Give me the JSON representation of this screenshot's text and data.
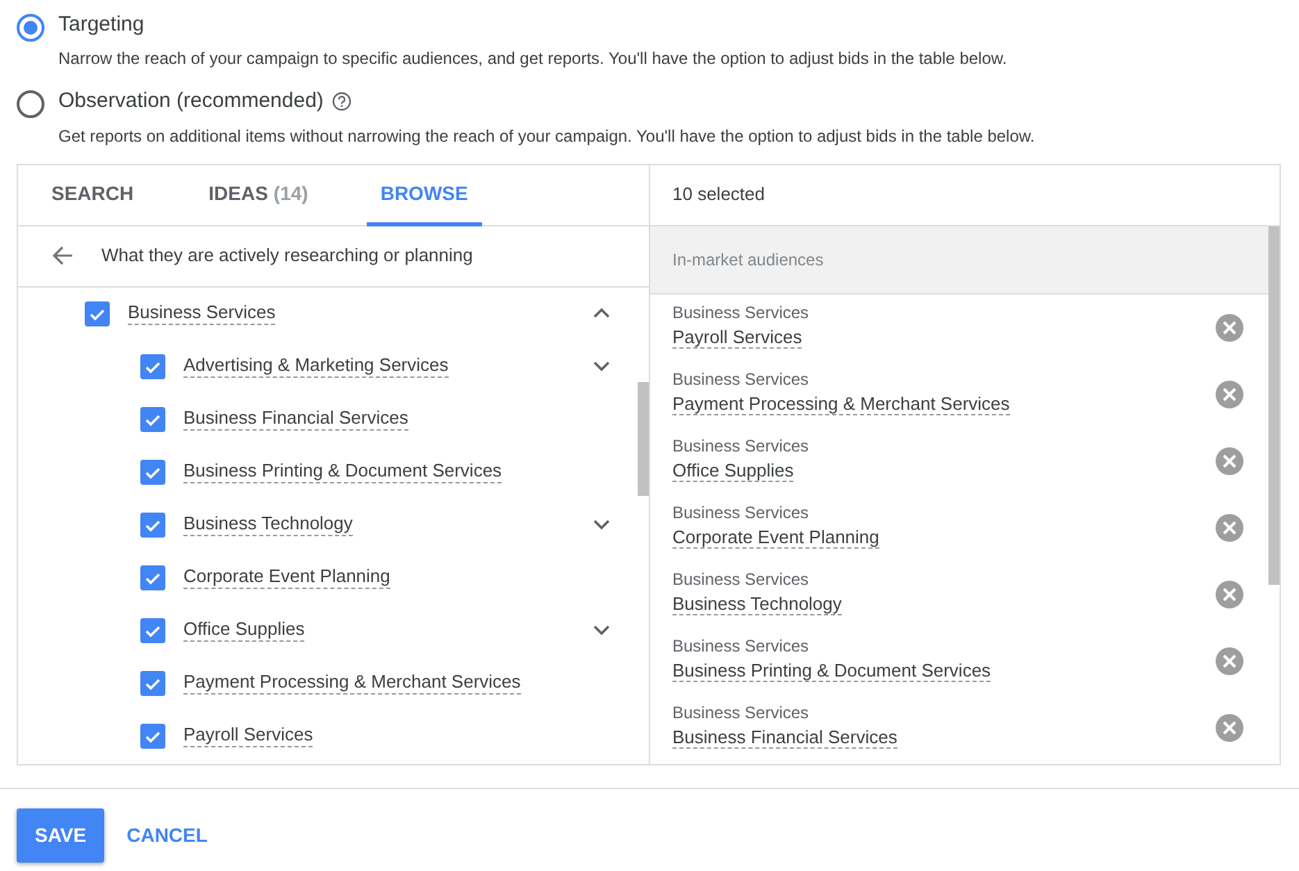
{
  "options": [
    {
      "label": "Targeting",
      "description": "Narrow the reach of your campaign to specific audiences, and get reports. You'll have the option to adjust bids in the table below.",
      "selected": true,
      "help": false
    },
    {
      "label": "Observation (recommended)",
      "description": "Get reports on additional items without narrowing the reach of your campaign. You'll have the option to adjust bids in the table below.",
      "selected": false,
      "help": true
    }
  ],
  "tabs": [
    {
      "label": "SEARCH",
      "selected": false
    },
    {
      "label": "IDEAS",
      "count": "(14)",
      "selected": false
    },
    {
      "label": "BROWSE",
      "selected": true
    }
  ],
  "browse": {
    "title": "What they are actively researching or planning",
    "tree": [
      {
        "label": "Business Services",
        "checked": true,
        "expanded": true,
        "children": [
          {
            "label": "Advertising & Marketing Services",
            "checked": true,
            "expanded": false
          },
          {
            "label": "Business Financial Services",
            "checked": true
          },
          {
            "label": "Business Printing & Document Services",
            "checked": true
          },
          {
            "label": "Business Technology",
            "checked": true,
            "expanded": false
          },
          {
            "label": "Corporate Event Planning",
            "checked": true
          },
          {
            "label": "Office Supplies",
            "checked": true,
            "expanded": false
          },
          {
            "label": "Payment Processing & Merchant Services",
            "checked": true
          },
          {
            "label": "Payroll Services",
            "checked": true
          }
        ]
      }
    ]
  },
  "selection": {
    "count_label": "10 selected",
    "section": "In-market audiences",
    "items": [
      {
        "category": "Business Services",
        "label": "Payroll Services"
      },
      {
        "category": "Business Services",
        "label": "Payment Processing & Merchant Services"
      },
      {
        "category": "Business Services",
        "label": "Office Supplies"
      },
      {
        "category": "Business Services",
        "label": "Corporate Event Planning"
      },
      {
        "category": "Business Services",
        "label": "Business Technology"
      },
      {
        "category": "Business Services",
        "label": "Business Printing & Document Services"
      },
      {
        "category": "Business Services",
        "label": "Business Financial Services"
      }
    ]
  },
  "buttons": [
    {
      "label": "SAVE",
      "kind": "primary"
    },
    {
      "label": "CANCEL",
      "kind": "flat"
    }
  ]
}
